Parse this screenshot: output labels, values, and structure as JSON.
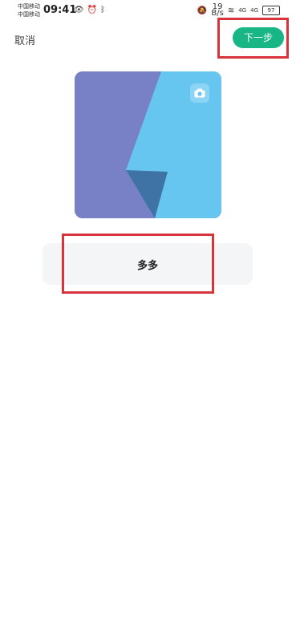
{
  "status_bar": {
    "carrier_1": "中国移动",
    "carrier_2": "中国移动",
    "time": "09:41",
    "net_speed_value": "19",
    "net_speed_unit": "B/s",
    "signal_1": "4G",
    "signal_2": "4G",
    "battery": "97"
  },
  "header": {
    "cancel_label": "取消",
    "next_label": "下一步"
  },
  "cover": {
    "colors": {
      "left": "#7981c6",
      "right": "#66c6f0",
      "fold": "#3f72a5"
    }
  },
  "name_field": {
    "value": "多多"
  },
  "colors": {
    "accent": "#17b684",
    "highlight": "#d8323a"
  }
}
